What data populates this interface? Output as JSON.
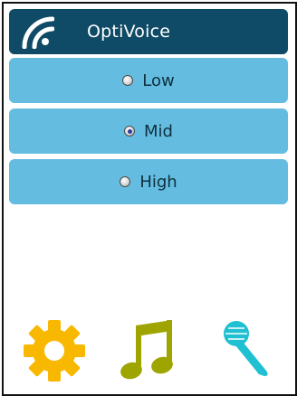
{
  "header": {
    "title": "OptiVoice",
    "logo_icon": "signal-arcs-icon"
  },
  "options": [
    {
      "label": "Low",
      "selected": false
    },
    {
      "label": "Mid",
      "selected": true
    },
    {
      "label": "High",
      "selected": false
    }
  ],
  "toolbar": [
    {
      "icon": "gear-icon",
      "color": "#f9b800"
    },
    {
      "icon": "music-note-icon",
      "color": "#9ea400"
    },
    {
      "icon": "microphone-icon",
      "color": "#1fc0d2"
    }
  ],
  "colors": {
    "header_bg": "#0f4b66",
    "option_bg": "#64bde0",
    "option_text": "#0e2f3e"
  }
}
